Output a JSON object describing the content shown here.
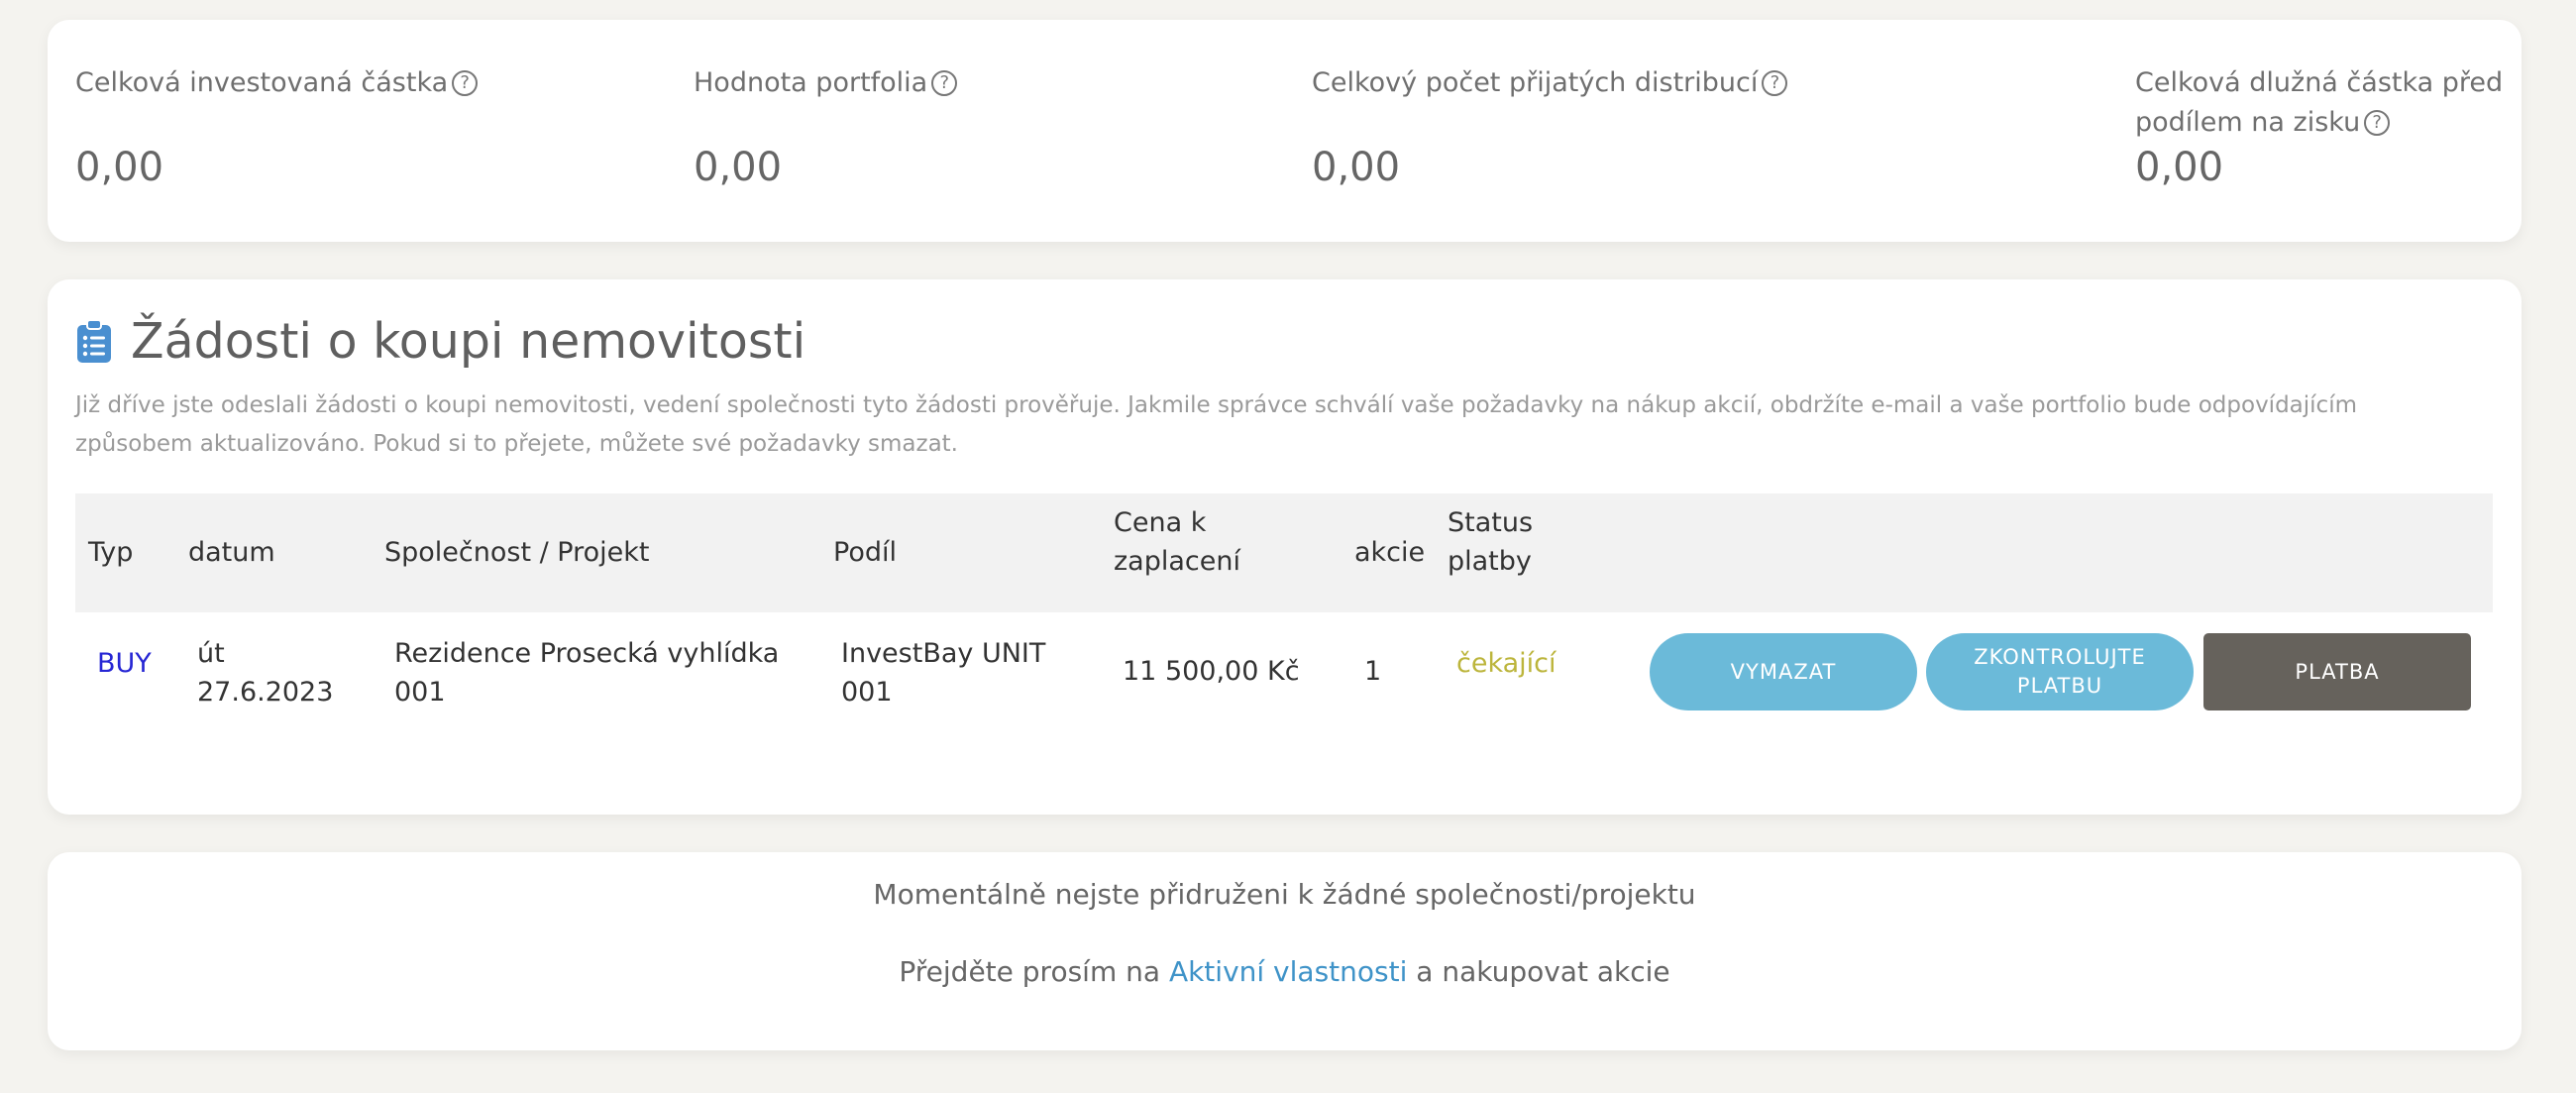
{
  "stats": [
    {
      "label": "Celková investovaná částka",
      "value": "0,00"
    },
    {
      "label": "Hodnota portfolia",
      "value": "0,00"
    },
    {
      "label": "Celkový počet přijatých distribucí",
      "value": "0,00"
    },
    {
      "label_line1": "Celková dlužná částka před",
      "label_line2": "podílem na zisku",
      "value": "0,00"
    }
  ],
  "requests": {
    "icon": "clipboard-icon",
    "title": "Žádosti o koupi nemovitosti",
    "description": "Již dříve jste odeslali žádosti o koupi nemovitosti, vedení společnosti tyto žádosti prověřuje. Jakmile správce schválí vaše požadavky na nákup akcií, obdržíte e-mail a vaše portfolio bude odpovídajícím způsobem aktualizováno. Pokud si to přejete, můžete své požadavky smazat.",
    "columns": {
      "typ": "Typ",
      "datum": "datum",
      "company": "Společnost / Projekt",
      "share": "Podíl",
      "price_line1": "Cena k",
      "price_line2": "zaplacení",
      "shares": "akcie",
      "status_line1": "Status",
      "status_line2": "platby"
    },
    "rows": [
      {
        "type": "BUY",
        "date_line1": "út",
        "date_line2": "27.6.2023",
        "company_line1": "Rezidence Prosecká vyhlídka",
        "company_line2": "001",
        "share_line1": "InvestBay UNIT",
        "share_line2": "001",
        "price": "11 500,00 Kč",
        "shares": "1",
        "status": "čekající",
        "delete_label": "VYMAZAT",
        "check_line1": "ZKONTROLUJTE",
        "check_line2": "PLATBU",
        "pay_label": "PLATBA"
      }
    ]
  },
  "info": {
    "line1": "Momentálně nejste přidruženi k žádné společnosti/projektu",
    "line2_before": "Přejděte prosím na",
    "link": "Aktivní vlastnosti",
    "line2_after": "a nakupovat akcie"
  },
  "colors": {
    "background": "#f4f3ef",
    "buy": "#2626d4",
    "status_pending": "#bcb53c",
    "button_blue": "#6bbad9",
    "button_dark": "#66625c",
    "link": "#3f93c8",
    "icon": "#4a8fd0"
  }
}
